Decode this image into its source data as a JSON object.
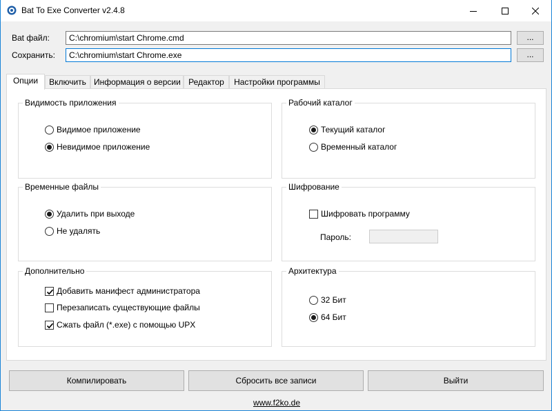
{
  "window": {
    "title": "Bat To Exe Converter v2.4.8",
    "icon": "gear-icon",
    "controls": [
      "minimize-icon",
      "maximize-icon",
      "close-icon"
    ]
  },
  "paths": {
    "bat_label": "Bat файл:",
    "bat_value": "C:\\chromium\\start Chrome.cmd",
    "save_label": "Сохранить:",
    "save_value": "C:\\chromium\\start Chrome.exe",
    "browse_label": "..."
  },
  "tabs": [
    {
      "label": "Опции",
      "active": true
    },
    {
      "label": "Включить",
      "active": false
    },
    {
      "label": "Информация о версии",
      "active": false
    },
    {
      "label": "Редактор",
      "active": false
    },
    {
      "label": "Настройки программы",
      "active": false
    }
  ],
  "groups": {
    "visibility": {
      "title": "Видимость приложения",
      "options": [
        {
          "label": "Видимое приложение",
          "checked": false
        },
        {
          "label": "Невидимое приложение",
          "checked": true
        }
      ]
    },
    "workdir": {
      "title": "Рабочий каталог",
      "options": [
        {
          "label": "Текущий каталог",
          "checked": true
        },
        {
          "label": "Временный каталог",
          "checked": false
        }
      ]
    },
    "tempfiles": {
      "title": "Временные файлы",
      "options": [
        {
          "label": "Удалить при выходе",
          "checked": true
        },
        {
          "label": "Не удалять",
          "checked": false
        }
      ]
    },
    "encryption": {
      "title": "Шифрование",
      "encrypt_label": "Шифровать программу",
      "encrypt_checked": false,
      "password_label": "Пароль:",
      "password_value": ""
    },
    "extra": {
      "title": "Дополнительно",
      "options": [
        {
          "label": "Добавить манифест администратора",
          "checked": true
        },
        {
          "label": "Перезаписать существующие файлы",
          "checked": false
        },
        {
          "label": "Сжать файл (*.exe) с помощью UPX",
          "checked": true
        }
      ]
    },
    "arch": {
      "title": "Архитектура",
      "options": [
        {
          "label": "32 Бит",
          "checked": false
        },
        {
          "label": "64 Бит",
          "checked": true
        }
      ]
    }
  },
  "buttons": {
    "compile": "Компилировать",
    "reset": "Сбросить все записи",
    "exit": "Выйти"
  },
  "footer": {
    "link": "www.f2ko.de"
  }
}
